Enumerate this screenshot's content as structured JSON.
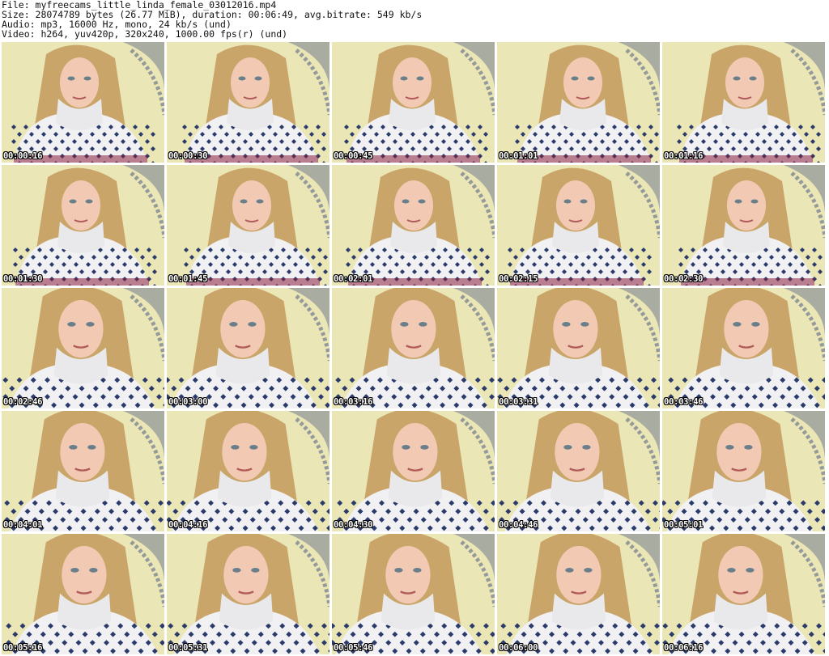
{
  "header": {
    "file": "File: myfreecams_little_linda_female_03012016.mp4",
    "size": "Size: 28074789 bytes (26.77 MiB), duration: 00:06:49, avg.bitrate: 549 kb/s",
    "audio": "Audio: mp3, 16000 Hz, mono, 24 kb/s (und)",
    "video": "Video: h264, yuv420p, 320x240, 1000.00 fps(r) (und)"
  },
  "thumbnails": [
    {
      "timestamp": "00:00:16"
    },
    {
      "timestamp": "00:00:30"
    },
    {
      "timestamp": "00:00:45"
    },
    {
      "timestamp": "00:01:01"
    },
    {
      "timestamp": "00:01:16"
    },
    {
      "timestamp": "00:01:30"
    },
    {
      "timestamp": "00:01:45"
    },
    {
      "timestamp": "00:02:01"
    },
    {
      "timestamp": "00:02:15"
    },
    {
      "timestamp": "00:02:30"
    },
    {
      "timestamp": "00:02:46"
    },
    {
      "timestamp": "00:03:00"
    },
    {
      "timestamp": "00:03:16"
    },
    {
      "timestamp": "00:03:31"
    },
    {
      "timestamp": "00:03:46"
    },
    {
      "timestamp": "00:04:01"
    },
    {
      "timestamp": "00:04:16"
    },
    {
      "timestamp": "00:04:30"
    },
    {
      "timestamp": "00:04:46"
    },
    {
      "timestamp": "00:05:01"
    },
    {
      "timestamp": "00:05:16"
    },
    {
      "timestamp": "00:05:31"
    },
    {
      "timestamp": "00:05:46"
    },
    {
      "timestamp": "00:06:00"
    },
    {
      "timestamp": "00:06:16"
    }
  ],
  "colors": {
    "wall": "#ebe6b5",
    "hair": "#c9a56a",
    "skin": "#f2c9b3",
    "sweater": "#f1f1f3",
    "pattern": "#2a3a6a",
    "accent": "#8a2040"
  }
}
